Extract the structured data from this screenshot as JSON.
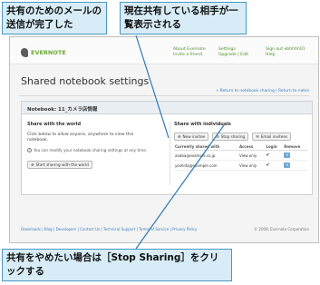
{
  "callouts": {
    "sent_done": "共有のためのメールの送信が完了した",
    "list_shown": "現在共有している相手が一覧表示される",
    "stop_hint": "共有をやめたい場合は［Stop Sharing］をクリックする"
  },
  "header": {
    "logo_text": "EVERNOTE",
    "nav": [
      [
        "About Evernote",
        "Invite a friend"
      ],
      [
        "Settings",
        "Upgrade | Edit"
      ],
      [
        "Sign out ebhhhh01",
        "Help"
      ]
    ]
  },
  "page": {
    "title": "Shared notebook settings",
    "back_links": "« Return to notebook sharing  | Return to notes"
  },
  "notebook": {
    "header": "Notebook: 11_カメラ店情報",
    "world": {
      "title": "Share with the world",
      "description": "Click below to allow anyone, anywhere to view this notebook.",
      "note": "You can modify your notebook sharing settings at any time.",
      "button": "Start sharing with the world"
    },
    "individuals": {
      "title": "Share with individuals",
      "buttons": {
        "new_invitee": "New invitee",
        "stop_sharing": "Stop sharing",
        "email_invitees": "Email invitees"
      },
      "columns": [
        "Currently shared with",
        "Access",
        "Login",
        "Remove"
      ],
      "rows": [
        {
          "email": "aoaba@example.co.jp",
          "access": "View only",
          "login": "✔"
        },
        {
          "email": "yoshida@example.com",
          "access": "View only",
          "login": "✔"
        }
      ]
    }
  },
  "footer": {
    "links": "Downloads | Blog | Developers | Contact Us | Technical Support | Terms of Service | Privacy Policy",
    "copyright": "© 2008, Evernote Corporation"
  },
  "colors": {
    "callout_bg": "#d7ecf6",
    "callout_border": "#4a97c2",
    "brand_green": "#6fa83a",
    "link_blue": "#3d7fb8"
  }
}
